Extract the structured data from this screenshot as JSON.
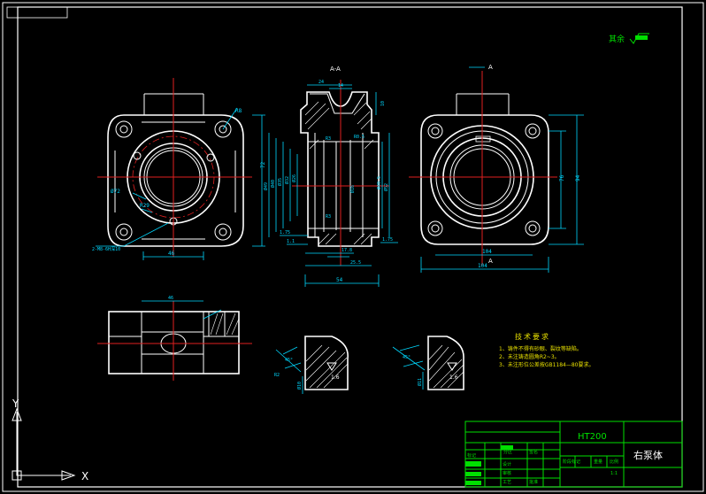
{
  "title_block": {
    "material": "HT200",
    "part_name": "右泵体",
    "scale": "1:1",
    "small_labels": [
      "分区",
      "签名",
      "标记",
      "设计",
      "审核",
      "工艺",
      "批准",
      "阶段标记",
      "重量",
      "比例"
    ]
  },
  "surface_finish_note": "其余",
  "tech_requirements": {
    "heading": "技术要求",
    "items": [
      "1、铸件不得有砂眼、裂纹等缺陷。",
      "2、未注铸造圆角R2~3。",
      "3、未注形位公差按GB1184—80要求。"
    ]
  },
  "section_labels": {
    "section_aa": "A-A",
    "cut_a_top": "A",
    "cut_a_bottom": "A"
  },
  "dimensions": {
    "front_view": [
      "R8",
      "R26",
      "Ø72",
      "R29",
      "46",
      "72",
      "2-M8-6H深10"
    ],
    "section_view": [
      "24",
      "14",
      "10",
      "Ø49",
      "Ø40",
      "Ø35",
      "Ø32",
      "Ø26",
      "Ø16",
      "Ø49.5",
      "Ø52",
      "Ø62",
      "R3",
      "R0.5",
      "1.75",
      "1.1",
      "1.75",
      "2.75",
      "17.8",
      "25.5",
      "54"
    ],
    "right_view": [
      "76",
      "94",
      "10",
      "104"
    ],
    "detail_views": [
      "1.6",
      "1.6",
      "Ø10",
      "Ø11",
      "45°",
      "R2"
    ]
  },
  "axis_icon": {
    "x_label": "X",
    "y_label": "Y"
  }
}
